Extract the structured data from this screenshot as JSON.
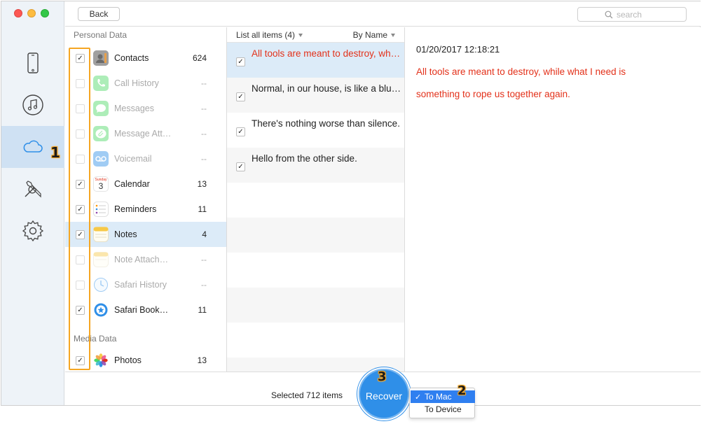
{
  "toolbar": {
    "back_label": "Back",
    "search_placeholder": "search"
  },
  "sidebar": {
    "items": [
      {
        "icon": "iphone-icon"
      },
      {
        "icon": "music-icon"
      },
      {
        "icon": "cloud-icon",
        "active": true
      },
      {
        "icon": "tools-icon"
      },
      {
        "icon": "gear-icon"
      }
    ],
    "step_badge": "1"
  },
  "categories": {
    "personal_label": "Personal Data",
    "media_label": "Media Data",
    "items": [
      {
        "name": "Contacts",
        "count": "624",
        "checked": true
      },
      {
        "name": "Call History",
        "count": "--",
        "checked": false
      },
      {
        "name": "Messages",
        "count": "--",
        "checked": false
      },
      {
        "name": "Message Att…",
        "count": "--",
        "checked": false
      },
      {
        "name": "Voicemail",
        "count": "--",
        "checked": false
      },
      {
        "name": "Calendar",
        "count": "13",
        "checked": true
      },
      {
        "name": "Reminders",
        "count": "11",
        "checked": true
      },
      {
        "name": "Notes",
        "count": "4",
        "checked": true
      },
      {
        "name": "Note Attach…",
        "count": "--",
        "checked": false
      },
      {
        "name": "Safari History",
        "count": "--",
        "checked": false
      },
      {
        "name": "Safari Book…",
        "count": "11",
        "checked": true
      },
      {
        "name": "Photos",
        "count": "13",
        "checked": true
      }
    ],
    "calendar_day_label": "Sunday",
    "calendar_day_number": "3"
  },
  "list": {
    "filter_label": "List all items (4)",
    "sort_label": "By Name",
    "items": [
      {
        "text": "All tools are meant to destroy, while what I need is something to rope us together again."
      },
      {
        "text": "Normal, in our house, is like a blue moon."
      },
      {
        "text": "There's nothing worse than silence."
      },
      {
        "text": "Hello from the other side."
      }
    ]
  },
  "detail": {
    "date": "01/20/2017 12:18:21",
    "body": "All tools are meant to destroy, while what I need is something to rope us together again."
  },
  "bottom": {
    "selected_text": "Selected 712 items",
    "recover_label": "Recover",
    "recover_step": "3",
    "menu_step": "2",
    "menu_items": [
      {
        "label": "To Mac",
        "checked_mark": "✓"
      },
      {
        "label": "To Device"
      }
    ]
  },
  "colors": {
    "accent": "#2f8fe8",
    "highlight_text": "#e3311a",
    "selection_bg": "#dcebf8",
    "annotation": "#f5a623"
  }
}
